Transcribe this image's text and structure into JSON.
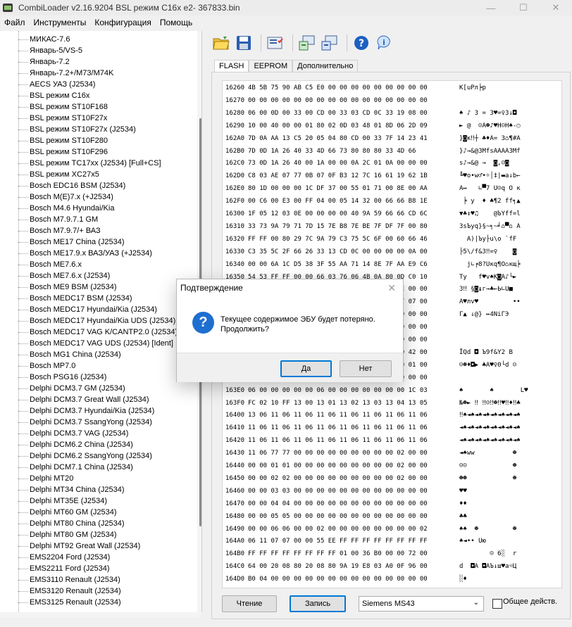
{
  "window": {
    "title": "CombiLoader v2.16.9204 BSL режим C16x e2- 367833.bin",
    "minimize": "—",
    "maximize": "☐",
    "close": "✕"
  },
  "menu": [
    "Файл",
    "Инструменты",
    "Конфигурация",
    "Помощь"
  ],
  "toolbar": {
    "icons": [
      "open-folder-icon",
      "save-disk-icon",
      "checklist-icon",
      "connect-green-icon",
      "connect-blue-icon",
      "help-icon",
      "info-icon"
    ]
  },
  "tree": {
    "items": [
      "МИКАС-7.6",
      "Январь-5/VS-5",
      "Январь-7.2",
      "Январь-7.2+/M73/M74K",
      "AECS УАЗ (J2534)",
      "BSL режим C16x",
      "BSL режим ST10F168",
      "BSL режим ST10F27x",
      "BSL режим ST10F27x (J2534)",
      "BSL режим ST10F280",
      "BSL режим ST10F296",
      "BSL режим TC17xx (J2534) [Full+CS]",
      "BSL режим XC27x5",
      "Bosch EDC16 BSM (J2534)",
      "Bosch M(E)7.x (+J2534)",
      "Bosch M4.6 Hyundai/Kia",
      "Bosch M7.9.7.1 GM",
      "Bosch M7.9.7/+ ВАЗ",
      "Bosch ME17 China (J2534)",
      "Bosch ME17.9.x ВАЗ/УАЗ (+J2534)",
      "Bosch ME7.6.x",
      "Bosch ME7.6.x (J2534)",
      "Bosch ME9 BSM (J2534)",
      "Bosch MEDC17 BSM (J2534)",
      "Bosch MEDC17 Hyundai/Kia (J2534)",
      "Bosch MEDC17 Hyundai/Kia UDS (J2534)",
      "Bosch MEDC17 VAG K/CANTP2.0 (J2534) [Ident]",
      "Bosch MEDC17 VAG UDS (J2534) [Ident]",
      "Bosch MG1 China (J2534)",
      "Bosch MP7.0",
      "Bosch PSG16 (J2534)",
      "Delphi DCM3.7 GM (J2534)",
      "Delphi DCM3.7 Great Wall (J2534)",
      "Delphi DCM3.7 Hyundai/Kia (J2534)",
      "Delphi DCM3.7 SsangYong (J2534)",
      "Delphi DCM3.7 VAG (J2534)",
      "Delphi DCM6.2 China (J2534)",
      "Delphi DCM6.2 SsangYong (J2534)",
      "Delphi DCM7.1 China (J2534)",
      "Delphi MT20",
      "Delphi MT34 China (J2534)",
      "Delphi MT35E (J2534)",
      "Delphi MT60 GM (J2534)",
      "Delphi MT80 China (J2534)",
      "Delphi MT80 GM (J2534)",
      "Delphi MT92 Great Wall (J2534)",
      "EMS2204 Ford (J2534)",
      "EMS2211 Ford (J2534)",
      "EMS3110 Renault (J2534)",
      "EMS3120 Renault (J2534)",
      "EMS3125 Renault (J2534)"
    ]
  },
  "tabs": [
    "FLASH",
    "EEPROM",
    "Дополнительно"
  ],
  "hex": {
    "rows": [
      {
        "addr": "16260",
        "bytes": "4B 5B 75 90 AB C5 E0 00 00 00 00 00 00 00 00 00",
        "ascii": "K[uРл╞р"
      },
      {
        "addr": "16270",
        "bytes": "00 00 00 00 00 00 00 00 00 00 00 00 00 00 00 00",
        "ascii": ""
      },
      {
        "addr": "16280",
        "bytes": "06 00 0D 00 33 00 CD 00 33 03 CD 0C 33 19 08 00",
        "ascii": "♠ ♪ 3 = 3♥=♀3↓◘"
      },
      {
        "addr": "16290",
        "bytes": "10 00 40 00 00 01 80 02 0D 03 48 01 8D 06 2D 09",
        "ascii": "► @  ☺А☻♪♥H☺Н♠-○"
      },
      {
        "addr": "162A0",
        "bytes": "7D 0A AA 13 C5 20 05 04 80 CD 00 33 7F 14 23 41",
        "ascii": "}◙к‼┼ ♣♦А= 3⌂¶#A"
      },
      {
        "addr": "162B0",
        "bytes": "7D 0D 1A 26 40 33 4D 66 73 80 80 80 33 4D 66",
        "ascii": "}♪→&@3MfsАААА3Mf"
      },
      {
        "addr": "162C0",
        "bytes": "73 0D 1A 26 40 00 1A 00 00 0A 2C 01 0A 00 00 00",
        "ascii": "s♪→&@ →  ◙,☺◙"
      },
      {
        "addr": "162D0",
        "bytes": "C8 03 AE 07 77 0B 07 0F B3 12 7C 16 61 19 62 1B",
        "ascii": "╚♥о•w♂•☼│‡|▬a↓b←"
      },
      {
        "addr": "162E0",
        "bytes": "80 1D 00 00 00 1C DF 37 00 55 01 71 00 8E 00 AA",
        "ascii": "А↔   ∟▀7 U☺q О к"
      },
      {
        "addr": "162F0",
        "bytes": "00 C6 00 E3 00 FF 04 00 05 14 32 00 66 66 B8 1E",
        "ascii": " ╞ у  ♦ ♣¶2 ff╕▲"
      },
      {
        "addr": "16300",
        "bytes": "1F 05 12 03 0E 00 00 00 00 40 9A 59 66 66 CD 6C",
        "ascii": "▼♣↕♥♫    @ЪYff=l"
      },
      {
        "addr": "16310",
        "bytes": "33 73 9A 79 71 7D 15 7E B8 7E BE 7F DF 7F 00 80",
        "ascii": "3sЪyq}§~╕~╛⌂▀⌂ А"
      },
      {
        "addr": "16320",
        "bytes": "FF FF 00 80 29 7C 9A 79 C3 75 5C 6F 00 60 66 46",
        "ascii": "  А)|Ъy├u\\o `fF"
      },
      {
        "addr": "16330",
        "bytes": "C3 35 5C 2F 66 26 33 13 CD 0C 00 00 00 00 0A 00",
        "ascii": "├5\\/f&3‼=♀    ◙"
      },
      {
        "addr": "16340",
        "bytes": "00 00 6A 1C D5 38 3F 55 AA 71 14 8E 7F AA E9 C6",
        "ascii": "  j∟╒8?Uкq¶О⌂кщ╞"
      },
      {
        "addr": "16350",
        "bytes": "54 53 FF FF 00 00 66 03 76 06 4B 0A 80 0D C0 10",
        "ascii": "Ty   f♥v♠K◙А♪└►"
      },
      {
        "addr": "16360",
        "bytes": "33 13 00 15 0A 17 A3 1A 05 1B 9C 1C 55 FE 00 00",
        "ascii": "3‼ §◙↨г→♣←Ь∟U■"
      },
      {
        "addr": "16370",
        "bytes": "80 03 AB 76 00 00 00 00 00 00 00 00 00 07 07 00",
        "ascii": "А♥лv♥         ••"
      },
      {
        "addr": "16380",
        "bytes": "82 00 00 00 00 1E 00 12 40 33 8D 00 00 00 00 00",
        "ascii": "Г▲ ↓@} ↔4NiГЭ"
      },
      {
        "addr": "16390",
        "bytes": "00 00 00 00 00 00 00 00 00 00 00 00 00 00 00 00",
        "ascii": ""
      },
      {
        "addr": "163A0",
        "bytes": "00 00 00 00 00 00 00 00 00 00 00 00 00 00 00 00",
        "ascii": ""
      },
      {
        "addr": "163B0",
        "bytes": "00 00 00 00 00 00 00 00 00 00 00 00 32 00 42 00",
        "ascii": "ЇQd ◘ Ъ9f&Y2 B"
      },
      {
        "addr": "163C0",
        "bytes": "00 00 00 00 00 00 00 00 00 00 00 00 64 00 01 00",
        "ascii": "☺☻♦◘▶ ♣A♥♀0└d ☺"
      },
      {
        "addr": "163D0",
        "bytes": "00 00 00 00 00 00 00 00 00 00 00 00 00 00 00 00",
        "ascii": ""
      },
      {
        "addr": "163E0",
        "bytes": "06 00 00 00 00 00 06 00 00 00 00 00 00 00 1C 03",
        "ascii": "♠       ♠       L♥"
      },
      {
        "addr": "163F0",
        "bytes": "FC 02 10 FF 13 00 13 01 13 02 13 03 13 04 13 05",
        "ascii": "№☻► ‼ ‼☺‼☻‼♥‼♦‼♣"
      },
      {
        "addr": "16400",
        "bytes": "13 06 11 06 11 06 11 06 11 06 11 06 11 06 11 06",
        "ascii": "‼♠◄♠◄♠◄♠◄♠◄♠◄♠◄♠"
      },
      {
        "addr": "16410",
        "bytes": "11 06 11 06 11 06 11 06 11 06 11 06 11 06 11 06",
        "ascii": "◄♠◄♠◄♠◄♠◄♠◄♠◄♠◄♠"
      },
      {
        "addr": "16420",
        "bytes": "11 06 11 06 11 06 11 06 11 06 11 06 11 06 11 06",
        "ascii": "◄♠◄♠◄♠◄♠◄♠◄♠◄♠◄♠"
      },
      {
        "addr": "16430",
        "bytes": "11 06 77 77 00 00 00 00 00 00 00 00 00 02 00 00",
        "ascii": "◄♠ww          ☻"
      },
      {
        "addr": "16440",
        "bytes": "00 00 01 01 00 00 00 00 00 00 00 00 00 02 00 00",
        "ascii": "☺☺            ☻"
      },
      {
        "addr": "16450",
        "bytes": "00 00 02 02 00 00 00 00 00 00 00 00 00 02 00 00",
        "ascii": "☻☻            ☻"
      },
      {
        "addr": "16460",
        "bytes": "00 00 03 03 00 00 00 00 00 00 00 00 00 00 00 00",
        "ascii": "♥♥"
      },
      {
        "addr": "16470",
        "bytes": "00 00 04 04 00 00 00 00 00 00 00 00 00 00 00 00",
        "ascii": "♦♦"
      },
      {
        "addr": "16480",
        "bytes": "00 00 05 05 00 00 00 00 00 00 00 00 00 00 00 00",
        "ascii": "♣♣"
      },
      {
        "addr": "16490",
        "bytes": "00 00 06 06 00 00 02 00 00 00 00 00 00 00 00 02",
        "ascii": "♠♠  ☻         ☻"
      },
      {
        "addr": "164A0",
        "bytes": "06 11 07 07 00 00 55 EE FF FF FF FF FF FF FF FF",
        "ascii": "♠◄•• Uю"
      },
      {
        "addr": "164B0",
        "bytes": "FF FF FF FF FF FF FF FF 01 00 36 B0 00 00 72 00",
        "ascii": "        ☺ 6░  r"
      },
      {
        "addr": "164C0",
        "bytes": "64 00 20 08 80 20 08 80 9A 19 E8 03 A0 0F 96 00",
        "ascii": "d  ◘А ◘АЪ↓ш♥а☼Ц"
      },
      {
        "addr": "164D0",
        "bytes": "B0 04 00 00 00 00 00 00 00 00 00 00 00 00 00 00",
        "ascii": "░♦"
      }
    ]
  },
  "buttons": {
    "read": "Чтение",
    "write": "Запись"
  },
  "ecu_select": {
    "value": "Siemens MS43"
  },
  "common_action": {
    "label": "Общее действ."
  },
  "dialog": {
    "title": "Подтверждение",
    "close": "✕",
    "icon": "?",
    "message_line1": "Текущее содержимое ЭБУ будет потеряно.",
    "message_line2": "Продолжить?",
    "yes": "Да",
    "no": "Нет"
  }
}
